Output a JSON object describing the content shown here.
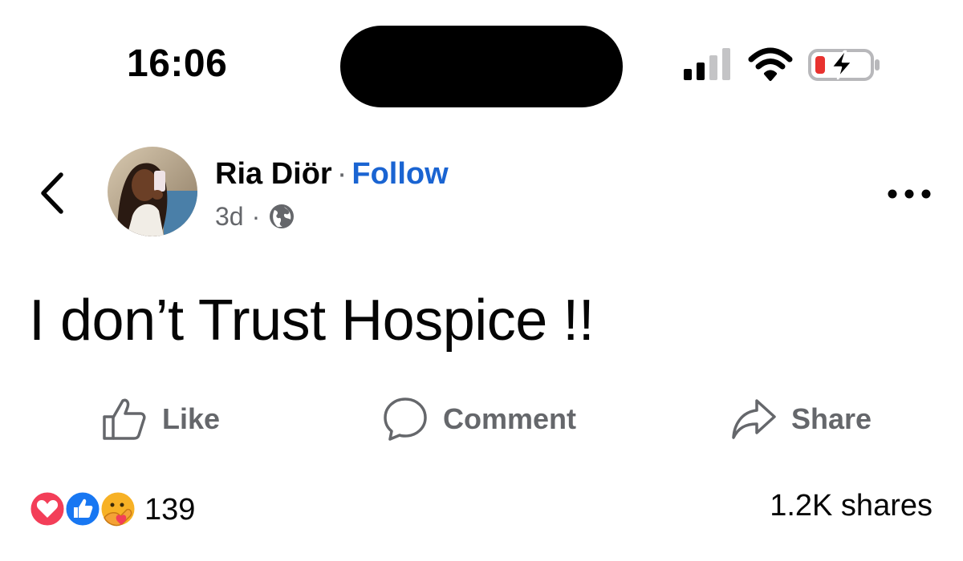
{
  "status_bar": {
    "time": "16:06",
    "battery_color": "#e8322f"
  },
  "post": {
    "author": "Ria Diör",
    "separator": "·",
    "follow_label": "Follow",
    "age": "3d",
    "meta_separator": "·",
    "audience_icon": "globe-icon",
    "text": "I don’t Trust Hospice !!"
  },
  "actions": {
    "like_label": "Like",
    "comment_label": "Comment",
    "share_label": "Share"
  },
  "reactions": {
    "types": [
      "love-icon",
      "like-icon",
      "care-icon"
    ],
    "count": "139"
  },
  "shares_text": "1.2K shares",
  "colors": {
    "follow_link": "#1a64d2",
    "secondary_text": "#65676b",
    "love": "#f33e58",
    "like": "#1877f2",
    "care": "#f7b125"
  }
}
